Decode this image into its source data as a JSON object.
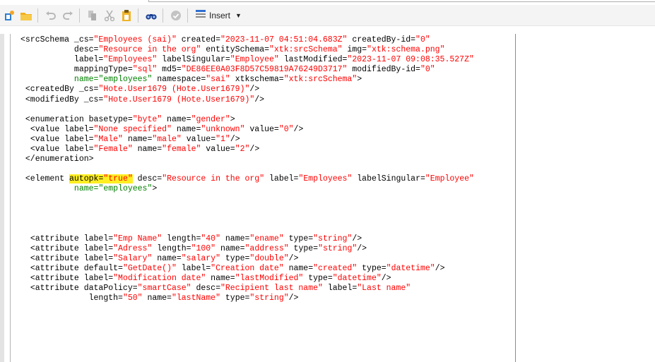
{
  "toolbar": {
    "insert_label": "Insert",
    "icons": [
      "new-icon",
      "open-folder-icon",
      "undo-icon",
      "redo-icon",
      "copy-icon",
      "cut-icon",
      "paste-icon",
      "find-icon",
      "validate-icon",
      "insert-icon",
      "dropdown-caret-icon"
    ]
  },
  "colors": {
    "attribute_name": "#000000",
    "attribute_value": "#ff0000",
    "alt_attribute": "#008000",
    "highlight": "#ffee22",
    "toolbar_bg": "#f4f4f4"
  },
  "code": {
    "lines": [
      {
        "indent": 0,
        "tokens": [
          {
            "t": "<srcSchema ",
            "c": "a"
          },
          {
            "t": "_cs=",
            "c": "a"
          },
          {
            "t": "\"Employees (sai)\"",
            "c": "v"
          },
          {
            "t": " created=",
            "c": "a"
          },
          {
            "t": "\"2023-11-07 04:51:04.683Z\"",
            "c": "v"
          },
          {
            "t": " createdBy-id=",
            "c": "a"
          },
          {
            "t": "\"0\"",
            "c": "v"
          }
        ]
      },
      {
        "indent": 11,
        "tokens": [
          {
            "t": "desc=",
            "c": "a"
          },
          {
            "t": "\"Resource in the org\"",
            "c": "v"
          },
          {
            "t": " entitySchema=",
            "c": "a"
          },
          {
            "t": "\"xtk:srcSchema\"",
            "c": "v"
          },
          {
            "t": " img=",
            "c": "a"
          },
          {
            "t": "\"xtk:schema.png\"",
            "c": "v"
          }
        ]
      },
      {
        "indent": 11,
        "tokens": [
          {
            "t": "label=",
            "c": "a"
          },
          {
            "t": "\"Employees\"",
            "c": "v"
          },
          {
            "t": " labelSingular=",
            "c": "a"
          },
          {
            "t": "\"Employee\"",
            "c": "v"
          },
          {
            "t": " lastModified=",
            "c": "a"
          },
          {
            "t": "\"2023-11-07 09:08:35.527Z\"",
            "c": "v"
          }
        ]
      },
      {
        "indent": 11,
        "tokens": [
          {
            "t": "mappingType=",
            "c": "a"
          },
          {
            "t": "\"sql\"",
            "c": "v"
          },
          {
            "t": " md5=",
            "c": "a"
          },
          {
            "t": "\"DE86EE0A03F8D57C59819A76249D3717\"",
            "c": "v"
          },
          {
            "t": " modifiedBy-id=",
            "c": "a"
          },
          {
            "t": "\"0\"",
            "c": "v"
          }
        ]
      },
      {
        "indent": 11,
        "tokens": [
          {
            "t": "name=",
            "c": "g"
          },
          {
            "t": "\"employees\"",
            "c": "g"
          },
          {
            "t": " namespace=",
            "c": "a"
          },
          {
            "t": "\"sai\"",
            "c": "v"
          },
          {
            "t": " xtkschema=",
            "c": "a"
          },
          {
            "t": "\"xtk:srcSchema\"",
            "c": "v"
          },
          {
            "t": ">",
            "c": "a"
          }
        ]
      },
      {
        "indent": 1,
        "tokens": [
          {
            "t": "<createdBy _cs=",
            "c": "a"
          },
          {
            "t": "\"Hote.User1679 (Hote.User1679)\"",
            "c": "v"
          },
          {
            "t": "/>",
            "c": "a"
          }
        ]
      },
      {
        "indent": 1,
        "tokens": [
          {
            "t": "<modifiedBy _cs=",
            "c": "a"
          },
          {
            "t": "\"Hote.User1679 (Hote.User1679)\"",
            "c": "v"
          },
          {
            "t": "/>",
            "c": "a"
          }
        ]
      },
      {
        "indent": 0,
        "tokens": []
      },
      {
        "indent": 1,
        "tokens": [
          {
            "t": "<enumeration basetype=",
            "c": "a"
          },
          {
            "t": "\"byte\"",
            "c": "v"
          },
          {
            "t": " name=",
            "c": "a"
          },
          {
            "t": "\"gender\"",
            "c": "v"
          },
          {
            "t": ">",
            "c": "a"
          }
        ]
      },
      {
        "indent": 2,
        "tokens": [
          {
            "t": "<value label=",
            "c": "a"
          },
          {
            "t": "\"None specified\"",
            "c": "v"
          },
          {
            "t": " name=",
            "c": "a"
          },
          {
            "t": "\"unknown\"",
            "c": "v"
          },
          {
            "t": " value=",
            "c": "a"
          },
          {
            "t": "\"0\"",
            "c": "v"
          },
          {
            "t": "/>",
            "c": "a"
          }
        ]
      },
      {
        "indent": 2,
        "tokens": [
          {
            "t": "<value label=",
            "c": "a"
          },
          {
            "t": "\"Male\"",
            "c": "v"
          },
          {
            "t": " name=",
            "c": "a"
          },
          {
            "t": "\"male\"",
            "c": "v"
          },
          {
            "t": " value=",
            "c": "a"
          },
          {
            "t": "\"1\"",
            "c": "v"
          },
          {
            "t": "/>",
            "c": "a"
          }
        ]
      },
      {
        "indent": 2,
        "tokens": [
          {
            "t": "<value label=",
            "c": "a"
          },
          {
            "t": "\"Female\"",
            "c": "v"
          },
          {
            "t": " name=",
            "c": "a"
          },
          {
            "t": "\"female\"",
            "c": "v"
          },
          {
            "t": " value=",
            "c": "a"
          },
          {
            "t": "\"2\"",
            "c": "v"
          },
          {
            "t": "/>",
            "c": "a"
          }
        ]
      },
      {
        "indent": 1,
        "tokens": [
          {
            "t": "</enumeration>",
            "c": "a"
          }
        ]
      },
      {
        "indent": 0,
        "tokens": []
      },
      {
        "indent": 1,
        "tokens": [
          {
            "t": "<element ",
            "c": "a"
          },
          {
            "t": "autopk=",
            "c": "a",
            "hl": true
          },
          {
            "t": "\"true\"",
            "c": "v",
            "hl": true
          },
          {
            "t": " desc=",
            "c": "a"
          },
          {
            "t": "\"Resource in the org\"",
            "c": "v"
          },
          {
            "t": " label=",
            "c": "a"
          },
          {
            "t": "\"Employees\"",
            "c": "v"
          },
          {
            "t": " labelSingular=",
            "c": "a"
          },
          {
            "t": "\"Employee\"",
            "c": "v"
          }
        ]
      },
      {
        "indent": 11,
        "tokens": [
          {
            "t": "name=",
            "c": "g"
          },
          {
            "t": "\"employees\"",
            "c": "g"
          },
          {
            "t": ">",
            "c": "a"
          }
        ]
      },
      {
        "indent": 0,
        "tokens": []
      },
      {
        "indent": 0,
        "tokens": []
      },
      {
        "indent": 0,
        "tokens": []
      },
      {
        "indent": 0,
        "tokens": []
      },
      {
        "indent": 2,
        "tokens": [
          {
            "t": "<attribute label=",
            "c": "a"
          },
          {
            "t": "\"Emp Name\"",
            "c": "v"
          },
          {
            "t": " length=",
            "c": "a"
          },
          {
            "t": "\"40\"",
            "c": "v"
          },
          {
            "t": " name=",
            "c": "a"
          },
          {
            "t": "\"ename\"",
            "c": "v"
          },
          {
            "t": " type=",
            "c": "a"
          },
          {
            "t": "\"string\"",
            "c": "v"
          },
          {
            "t": "/>",
            "c": "a"
          }
        ]
      },
      {
        "indent": 2,
        "tokens": [
          {
            "t": "<attribute label=",
            "c": "a"
          },
          {
            "t": "\"Adress\"",
            "c": "v"
          },
          {
            "t": " length=",
            "c": "a"
          },
          {
            "t": "\"100\"",
            "c": "v"
          },
          {
            "t": " name=",
            "c": "a"
          },
          {
            "t": "\"address\"",
            "c": "v"
          },
          {
            "t": " type=",
            "c": "a"
          },
          {
            "t": "\"string\"",
            "c": "v"
          },
          {
            "t": "/>",
            "c": "a"
          }
        ]
      },
      {
        "indent": 2,
        "tokens": [
          {
            "t": "<attribute label=",
            "c": "a"
          },
          {
            "t": "\"Salary\"",
            "c": "v"
          },
          {
            "t": " name=",
            "c": "a"
          },
          {
            "t": "\"salary\"",
            "c": "v"
          },
          {
            "t": " type=",
            "c": "a"
          },
          {
            "t": "\"double\"",
            "c": "v"
          },
          {
            "t": "/>",
            "c": "a"
          }
        ]
      },
      {
        "indent": 2,
        "tokens": [
          {
            "t": "<attribute default=",
            "c": "a"
          },
          {
            "t": "\"GetDate()\"",
            "c": "v"
          },
          {
            "t": " label=",
            "c": "a"
          },
          {
            "t": "\"Creation date\"",
            "c": "v"
          },
          {
            "t": " name=",
            "c": "a"
          },
          {
            "t": "\"created\"",
            "c": "v"
          },
          {
            "t": " type=",
            "c": "a"
          },
          {
            "t": "\"datetime\"",
            "c": "v"
          },
          {
            "t": "/>",
            "c": "a"
          }
        ]
      },
      {
        "indent": 2,
        "tokens": [
          {
            "t": "<attribute label=",
            "c": "a"
          },
          {
            "t": "\"Modification date\"",
            "c": "v"
          },
          {
            "t": " name=",
            "c": "a"
          },
          {
            "t": "\"lastModified\"",
            "c": "v"
          },
          {
            "t": " type=",
            "c": "a"
          },
          {
            "t": "\"datetime\"",
            "c": "v"
          },
          {
            "t": "/>",
            "c": "a"
          }
        ]
      },
      {
        "indent": 2,
        "tokens": [
          {
            "t": "<attribute dataPolicy=",
            "c": "a"
          },
          {
            "t": "\"smartCase\"",
            "c": "v"
          },
          {
            "t": " desc=",
            "c": "a"
          },
          {
            "t": "\"Recipient last name\"",
            "c": "v"
          },
          {
            "t": " label=",
            "c": "a"
          },
          {
            "t": "\"Last name\"",
            "c": "v"
          }
        ]
      },
      {
        "indent": 14,
        "tokens": [
          {
            "t": "length=",
            "c": "a"
          },
          {
            "t": "\"50\"",
            "c": "v"
          },
          {
            "t": " name=",
            "c": "a"
          },
          {
            "t": "\"lastName\"",
            "c": "v"
          },
          {
            "t": " type=",
            "c": "a"
          },
          {
            "t": "\"string\"",
            "c": "v"
          },
          {
            "t": "/>",
            "c": "a"
          }
        ]
      }
    ]
  }
}
